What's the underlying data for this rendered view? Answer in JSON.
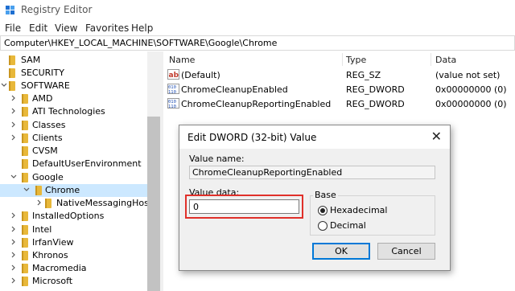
{
  "window": {
    "title": "Registry Editor"
  },
  "menu": [
    "File",
    "Edit",
    "View",
    "Favorites",
    "Help"
  ],
  "address": "Computer\\HKEY_LOCAL_MACHINE\\SOFTWARE\\Google\\Chrome",
  "tree": {
    "items": [
      {
        "label": "SAM",
        "expander": "none"
      },
      {
        "label": "SECURITY",
        "expander": "none"
      },
      {
        "label": "SOFTWARE",
        "expander": "expanded"
      },
      {
        "label": "AMD",
        "expander": "collapsed"
      },
      {
        "label": "ATI Technologies",
        "expander": "collapsed"
      },
      {
        "label": "Classes",
        "expander": "collapsed"
      },
      {
        "label": "Clients",
        "expander": "collapsed"
      },
      {
        "label": "CVSM",
        "expander": "none"
      },
      {
        "label": "DefaultUserEnvironment",
        "expander": "none"
      },
      {
        "label": "Google",
        "expander": "expanded"
      },
      {
        "label": "Chrome",
        "expander": "expanded",
        "selected": true
      },
      {
        "label": "NativeMessagingHosts",
        "expander": "collapsed"
      },
      {
        "label": "InstalledOptions",
        "expander": "collapsed"
      },
      {
        "label": "Intel",
        "expander": "collapsed"
      },
      {
        "label": "IrfanView",
        "expander": "collapsed"
      },
      {
        "label": "Khronos",
        "expander": "collapsed"
      },
      {
        "label": "Macromedia",
        "expander": "collapsed"
      },
      {
        "label": "Microsoft",
        "expander": "collapsed"
      }
    ]
  },
  "list": {
    "columns": [
      "Name",
      "Type",
      "Data"
    ],
    "rows": [
      {
        "name": "(Default)",
        "type": "REG_SZ",
        "data": "(value not set)",
        "icon": "string-value-icon"
      },
      {
        "name": "ChromeCleanupEnabled",
        "type": "REG_DWORD",
        "data": "0x00000000 (0)",
        "icon": "dword-value-icon"
      },
      {
        "name": "ChromeCleanupReportingEnabled",
        "type": "REG_DWORD",
        "data": "0x00000000 (0)",
        "icon": "dword-value-icon"
      }
    ]
  },
  "dialog": {
    "title": "Edit DWORD (32-bit) Value",
    "close": "✕",
    "value_name_label": "Value name:",
    "value_name": "ChromeCleanupReportingEnabled",
    "value_data_label": "Value data:",
    "value_data": "0",
    "base_label": "Base",
    "base_options": [
      "Hexadecimal",
      "Decimal"
    ],
    "base_selected": "Hexadecimal",
    "ok_label": "OK",
    "cancel_label": "Cancel"
  },
  "colors": {
    "folder": "#e8b83a",
    "selection": "#cce8ff",
    "highlight_box": "#e0302a",
    "default_button_border": "#0078d7"
  }
}
